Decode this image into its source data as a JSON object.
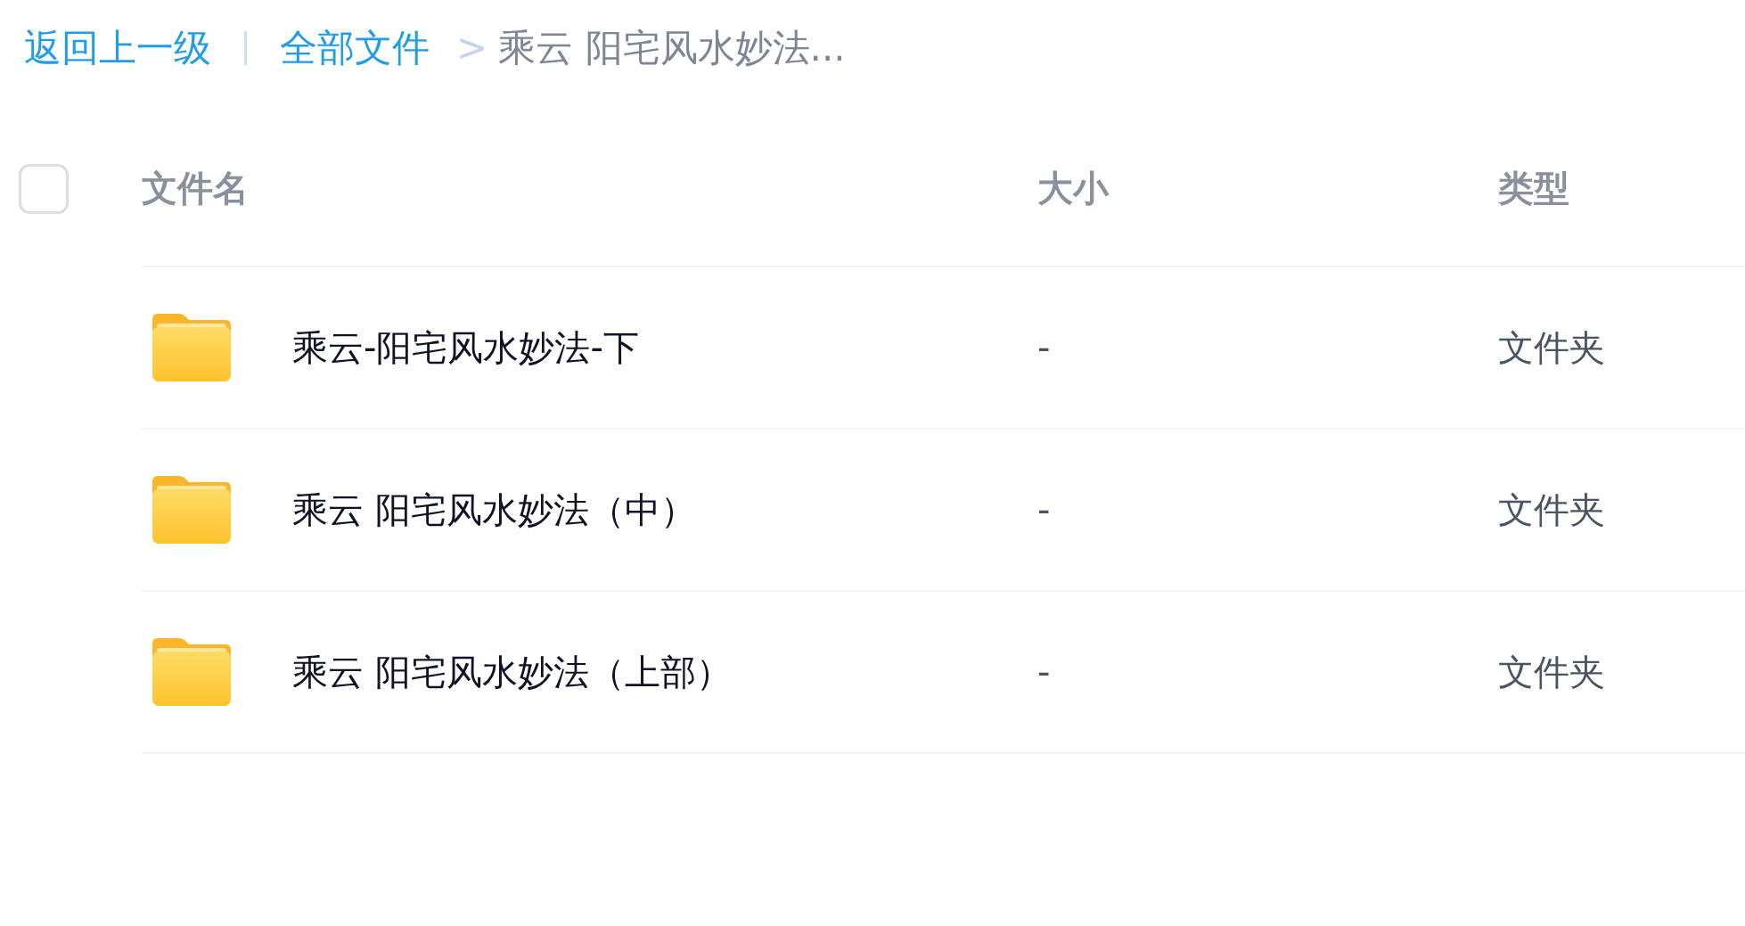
{
  "breadcrumb": {
    "back_link": "返回上一级",
    "items": [
      {
        "label": "全部文件",
        "kind": "link"
      },
      {
        "label": "乘云 阳宅风水妙法...",
        "kind": "current"
      }
    ],
    "separator": ">"
  },
  "table": {
    "select_all": {
      "checked": false
    },
    "columns": [
      "文件名",
      "大小",
      "类型"
    ],
    "rows": [
      {
        "name": "乘云-阳宅风水妙法-下",
        "size": "-",
        "type": "文件夹"
      },
      {
        "name": "乘云 阳宅风水妙法（中）",
        "size": "-",
        "type": "文件夹"
      },
      {
        "name": "乘云 阳宅风水妙法（上部）",
        "size": "-",
        "type": "文件夹"
      }
    ]
  }
}
